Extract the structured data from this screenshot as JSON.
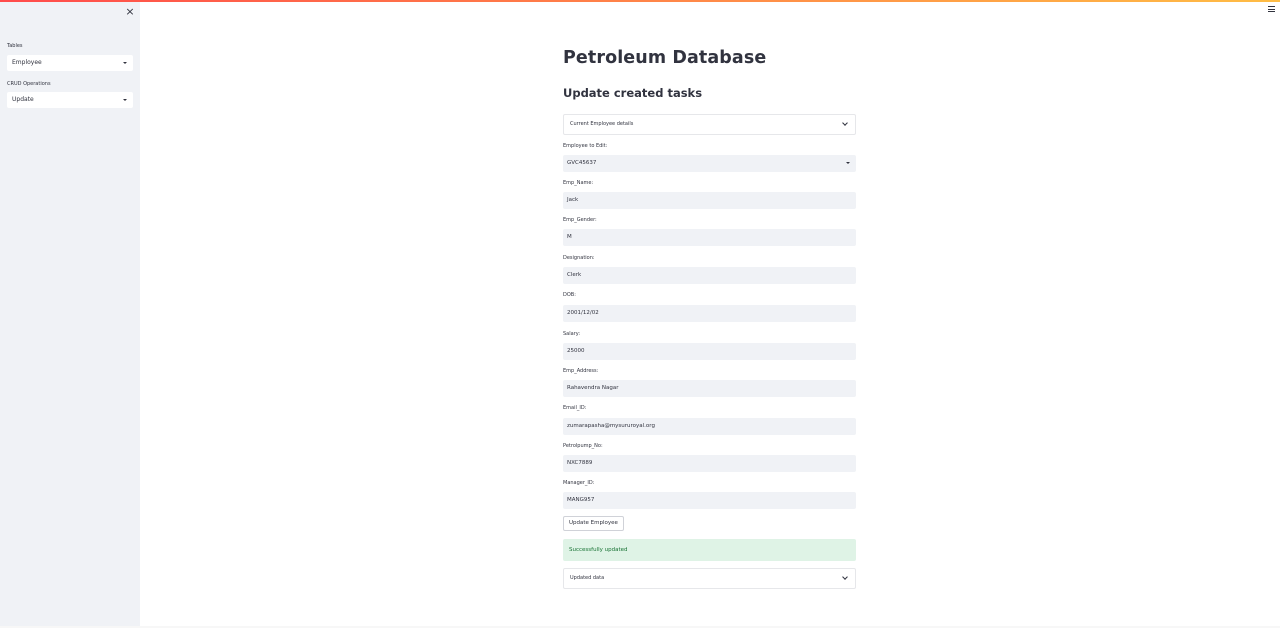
{
  "sidebar": {
    "close_glyph": "×",
    "tables_label": "Tables",
    "tables_value": "Employee",
    "crud_label": "CRUD Operations",
    "crud_value": "Update"
  },
  "header": {
    "menu_icon": "hamburger-menu-icon"
  },
  "main": {
    "title": "Petroleum Database",
    "subtitle": "Update created tasks",
    "current_expander": "Current Employee details",
    "employee_to_edit": {
      "label": "Employee to Edit:",
      "value": "GVC45637"
    },
    "fields": [
      {
        "label": "Emp_Name:",
        "value": "Jack"
      },
      {
        "label": "Emp_Gender:",
        "value": "M"
      },
      {
        "label": "Designation:",
        "value": "Clerk"
      },
      {
        "label": "DOB:",
        "value": "2001/12/02"
      },
      {
        "label": "Salary:",
        "value": "25000"
      },
      {
        "label": "Emp_Address:",
        "value": "Rahavendra Nagar"
      },
      {
        "label": "Email_ID:",
        "value": "zumarapasha@mysururoyal.org"
      },
      {
        "label": "Petrolpump_No:",
        "value": "NXC7889"
      },
      {
        "label": "Manager_ID:",
        "value": "MANG957"
      }
    ],
    "update_button": "Update Employee",
    "success_message": "Successfully updated",
    "updated_expander": "Updated data"
  },
  "colors": {
    "sidebar_bg": "#f0f2f6",
    "input_bg": "#f0f2f6",
    "success_bg": "#dff3e6",
    "success_text": "#177233",
    "accent_gradient_start": "#ff4b4b",
    "accent_gradient_end": "#ffbd45"
  }
}
